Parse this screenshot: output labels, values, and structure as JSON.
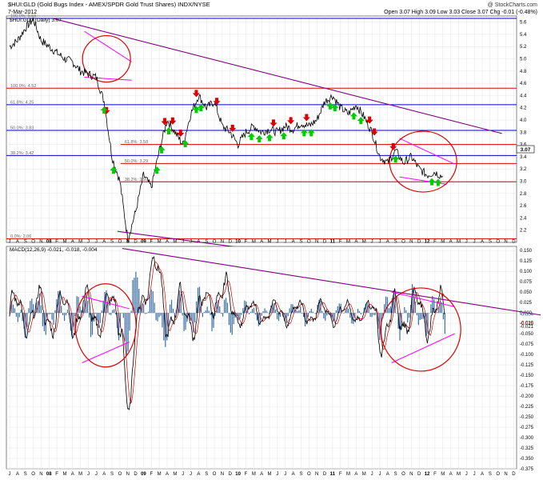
{
  "header": {
    "title": "$HUI:GLD (Gold Bugs Index - AMEX/SPDR Gold Trust Shares) INDX/NYSE",
    "watermark": "@ StockCharts.com",
    "date": "7-Mar-2012",
    "quote": "Open 3.07  High 3.09  Low 3.03  Close 3.07  Chg -0.01 (-0.48%)",
    "legend": "$HUI:GLD (Daily) 3.07",
    "last_value": "3.07"
  },
  "colors": {
    "price": "#000000",
    "fib_blue": "#0000cc",
    "fib_red": "#dd0000",
    "trend_purple": "#800080",
    "pennant_magenta": "#ff00ff",
    "circle_red": "#dd0000",
    "arrow_up": "#00cc00",
    "arrow_down": "#dd0000",
    "macd": "#000000",
    "signal": "#dd0000",
    "histogram": "#3a6ea5"
  },
  "time_axis": {
    "month_labels": [
      "J",
      "A",
      "S",
      "O",
      "N",
      "08",
      "F",
      "M",
      "A",
      "M",
      "J",
      "J",
      "A",
      "S",
      "O",
      "N",
      "D",
      "09",
      "F",
      "M",
      "A",
      "M",
      "J",
      "J",
      "A",
      "S",
      "O",
      "N",
      "D",
      "10",
      "F",
      "M",
      "A",
      "M",
      "J",
      "J",
      "A",
      "S",
      "O",
      "N",
      "D",
      "11",
      "F",
      "M",
      "A",
      "M",
      "J",
      "J",
      "A",
      "S",
      "O",
      "N",
      "D",
      "12",
      "F",
      "M",
      "A",
      "M",
      "J",
      "J",
      "A",
      "S",
      "O",
      "N",
      "D"
    ]
  },
  "chart_data": [
    {
      "type": "line",
      "name": "$HUI:GLD (Daily)",
      "ylim": [
        2.0,
        5.7
      ],
      "yticks": [
        "5.6",
        "5.4",
        "5.2",
        "5.0",
        "4.8",
        "4.6",
        "4.4",
        "4.2",
        "4.0",
        "3.8",
        "3.6",
        "3.4",
        "3.2",
        "3.0",
        "2.8",
        "2.6",
        "2.4",
        "2.2"
      ],
      "ytick_values": [
        5.6,
        5.4,
        5.2,
        5.0,
        4.8,
        4.6,
        4.4,
        4.2,
        4.0,
        3.8,
        3.6,
        3.4,
        3.2,
        3.0,
        2.8,
        2.6,
        2.4,
        2.2
      ],
      "x_unit": "month index (0 = Jul 2007)",
      "price_points": [
        [
          0,
          5.2
        ],
        [
          1,
          5.3
        ],
        [
          2,
          5.5
        ],
        [
          3,
          5.65
        ],
        [
          4,
          5.3
        ],
        [
          5,
          5.2
        ],
        [
          6,
          5.1
        ],
        [
          7,
          5.0
        ],
        [
          8,
          4.95
        ],
        [
          9,
          4.8
        ],
        [
          10,
          4.75
        ],
        [
          11,
          4.7
        ],
        [
          12,
          4.3
        ],
        [
          13,
          3.4
        ],
        [
          14,
          3.0
        ],
        [
          15,
          2.05
        ],
        [
          16,
          2.5
        ],
        [
          17,
          3.1
        ],
        [
          18,
          2.9
        ],
        [
          19,
          3.5
        ],
        [
          20,
          4.0
        ],
        [
          21,
          3.8
        ],
        [
          22,
          3.6
        ],
        [
          23,
          4.1
        ],
        [
          24,
          4.4
        ],
        [
          25,
          4.2
        ],
        [
          26,
          4.3
        ],
        [
          27,
          3.9
        ],
        [
          28,
          3.8
        ],
        [
          29,
          3.6
        ],
        [
          30,
          3.8
        ],
        [
          31,
          3.9
        ],
        [
          32,
          3.8
        ],
        [
          33,
          3.85
        ],
        [
          34,
          3.8
        ],
        [
          35,
          3.9
        ],
        [
          36,
          3.85
        ],
        [
          37,
          3.95
        ],
        [
          38,
          3.9
        ],
        [
          39,
          4.0
        ],
        [
          40,
          4.3
        ],
        [
          41,
          4.4
        ],
        [
          42,
          4.2
        ],
        [
          43,
          4.1
        ],
        [
          44,
          4.25
        ],
        [
          45,
          4.05
        ],
        [
          46,
          3.8
        ],
        [
          47,
          3.4
        ],
        [
          48,
          3.3
        ],
        [
          49,
          3.5
        ],
        [
          50,
          3.3
        ],
        [
          51,
          3.4
        ],
        [
          52,
          3.2
        ],
        [
          53,
          3.1
        ],
        [
          54,
          3.15
        ],
        [
          55,
          3.07
        ]
      ],
      "fib_levels": [
        {
          "label": "100.0%: 4.52",
          "value": 4.52,
          "color": "#dd0000"
        },
        {
          "label": "61.8%: 4.25",
          "value": 4.25,
          "color": "#0000cc"
        },
        {
          "label": "50.0%: 3.83",
          "value": 3.83,
          "color": "#0000cc"
        },
        {
          "label": "38.2%: 3.42",
          "value": 3.42,
          "color": "#0000cc"
        },
        {
          "label": "61.8%: 3.58",
          "value": 3.6,
          "color": "#dd0000"
        },
        {
          "label": "50.0%: 3.29",
          "value": 3.29,
          "color": "#dd0000"
        },
        {
          "label": "38.2%: 2.99",
          "value": 2.99,
          "color": "#dd0000"
        },
        {
          "label": "0.0%: 2.06",
          "value": 2.06,
          "color": "#dd0000"
        },
        {
          "label": "100.0%: 5.66",
          "value": 5.66,
          "color": "#0000cc"
        }
      ],
      "down_arrows_x": [
        12.3,
        19.7,
        20.7,
        21.7,
        23.7,
        26.3,
        28.3,
        33.5,
        35.7,
        37.7,
        45.7,
        46.3,
        48.7,
        55.2
      ],
      "up_arrows_x": [
        12.0,
        13.2,
        18.7,
        19.3,
        20.2,
        22.3,
        23.7,
        24.3,
        30.7,
        31.7,
        33.0,
        34.8,
        37.4,
        38.3,
        40.7,
        41.3,
        43.7,
        44.6,
        49.0,
        53.6,
        54.4
      ]
    },
    {
      "type": "line",
      "name": "MACD(12,26,9)",
      "legend": "MACD(12,26,9) -0.021, -0.018, -0.004",
      "ylim": [
        -0.375,
        0.16
      ],
      "yticks": [
        "0.150",
        "0.125",
        "0.100",
        "0.075",
        "0.050",
        "0.025",
        "0.000",
        "-0.025",
        "-0.050",
        "-0.075",
        "-0.100",
        "-0.125",
        "-0.150",
        "-0.175",
        "-0.200",
        "-0.225",
        "-0.250",
        "-0.275",
        "-0.300",
        "-0.325",
        "-0.350",
        "-0.375"
      ],
      "ytick_values": [
        0.15,
        0.125,
        0.1,
        0.075,
        0.05,
        0.025,
        0.0,
        -0.025,
        -0.05,
        -0.075,
        -0.1,
        -0.125,
        -0.15,
        -0.175,
        -0.2,
        -0.225,
        -0.25,
        -0.275,
        -0.3,
        -0.325,
        -0.35,
        -0.375
      ],
      "last_values": [
        "-0.004",
        "-0.018",
        "-0.021"
      ]
    }
  ]
}
